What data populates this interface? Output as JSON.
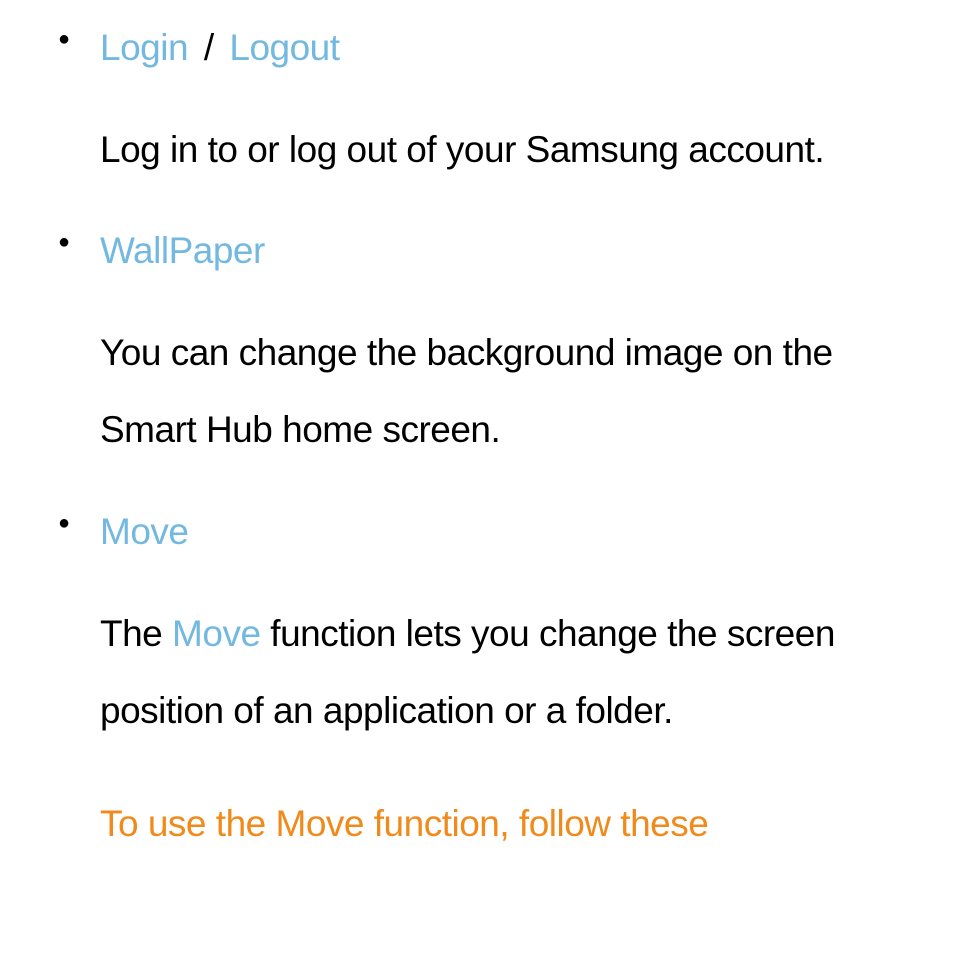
{
  "items": [
    {
      "heading_parts": {
        "login": "Login",
        "separator": "/",
        "logout": "Logout"
      },
      "description": "Log in to or log out of your Samsung account."
    },
    {
      "heading_wallpaper": "WallPaper",
      "description": "You can change the background image on the Smart Hub home screen."
    },
    {
      "heading_move": "Move",
      "description_prefix": "The ",
      "description_blue": "Move",
      "description_suffix": " function lets you change the screen position of an application or a folder.",
      "note": "To use the Move function, follow these"
    }
  ]
}
